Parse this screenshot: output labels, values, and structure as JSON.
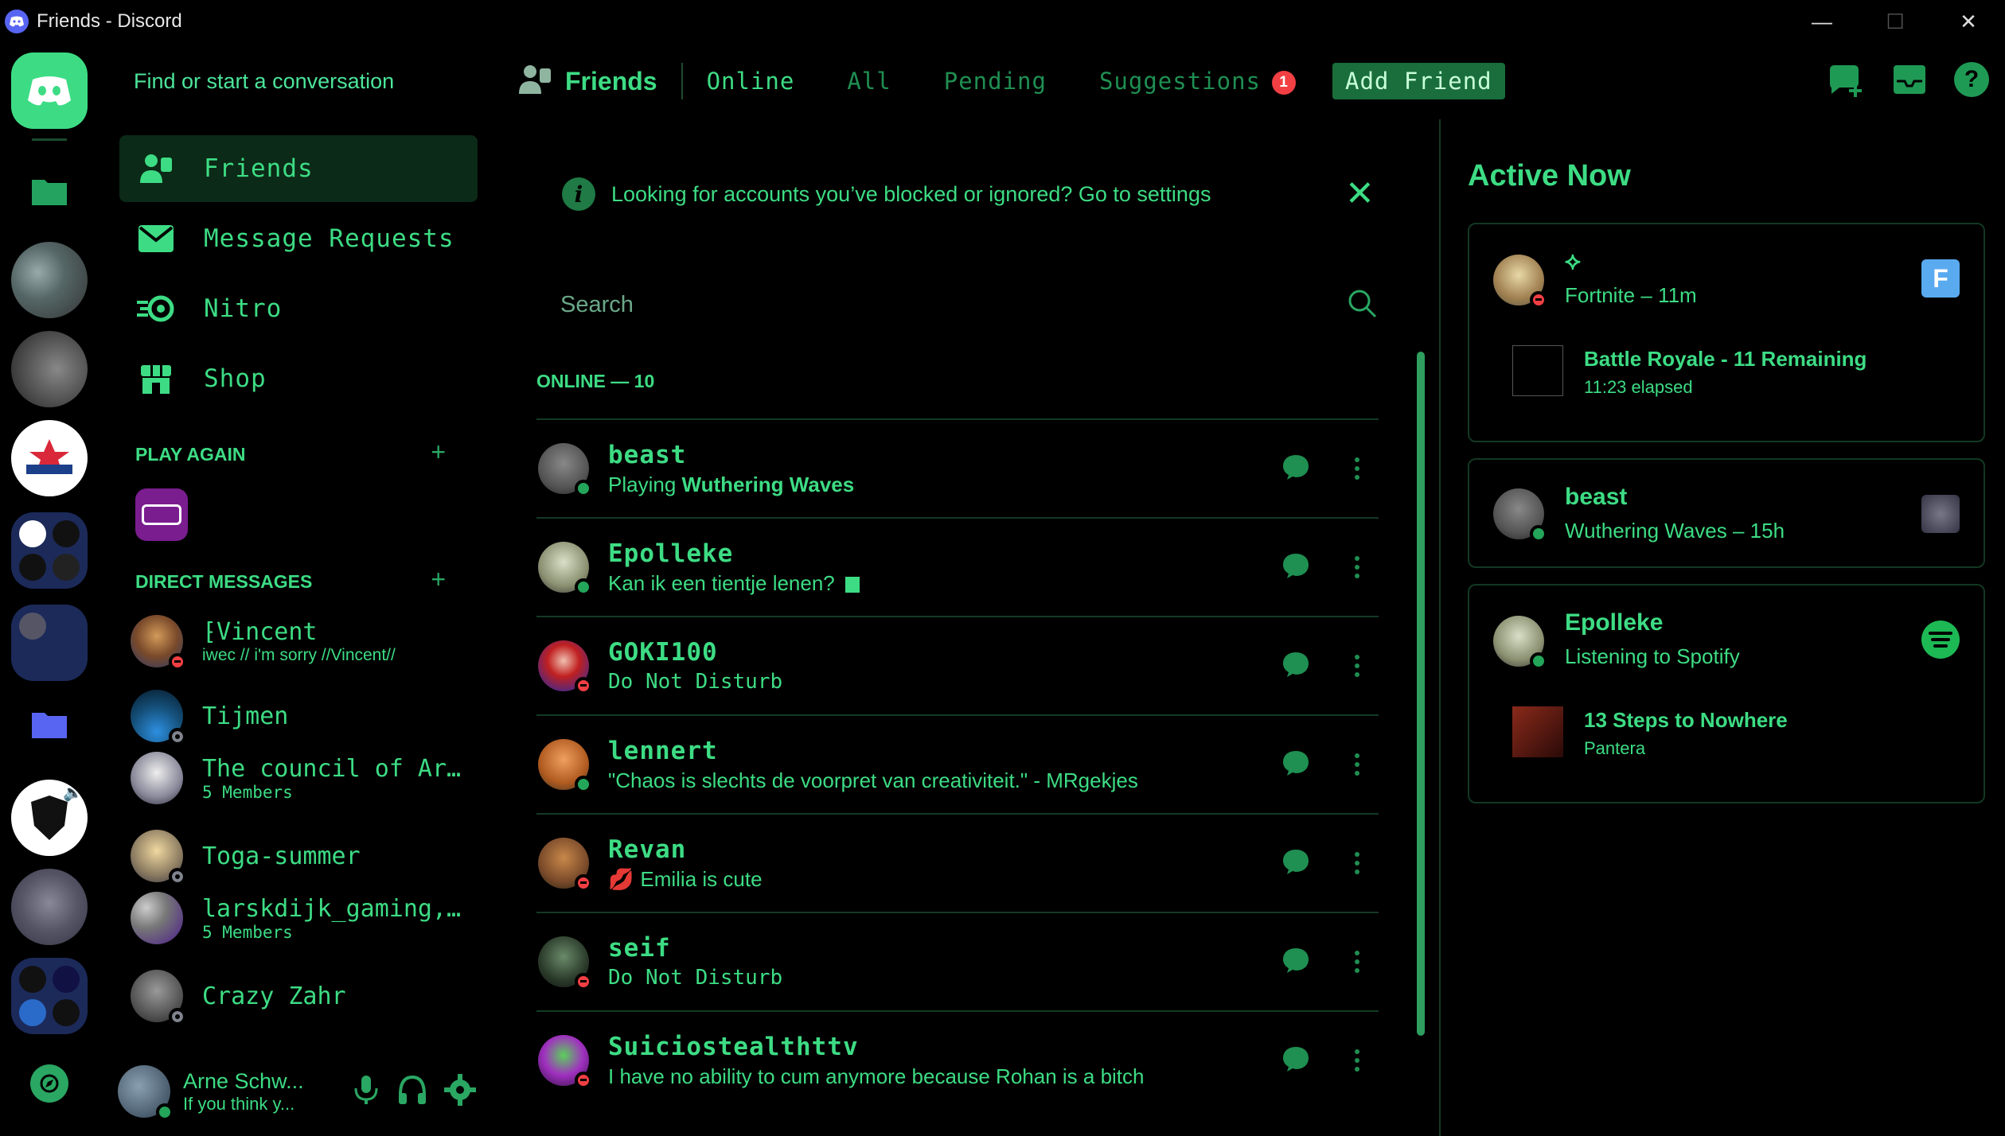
{
  "window": {
    "title": "Friends - Discord",
    "minimize": "—",
    "maximize": "☐",
    "close": "✕"
  },
  "sidebar": {
    "find_placeholder": "Find or start a conversation",
    "nav": [
      {
        "label": "Friends",
        "icon": "friends-icon",
        "active": true
      },
      {
        "label": "Message Requests",
        "icon": "envelope-icon"
      },
      {
        "label": "Nitro",
        "icon": "nitro-icon"
      },
      {
        "label": "Shop",
        "icon": "shop-icon"
      }
    ],
    "play_again_label": "PLAY AGAIN",
    "direct_messages_label": "DIRECT MESSAGES",
    "plus": "+",
    "dms": [
      {
        "name": "⁅Vincent",
        "sub": "iwec // i'm sorry //Vincent//",
        "status": "dnd"
      },
      {
        "name": "Tijmen",
        "sub": "",
        "status": "off"
      },
      {
        "name": "The council of Ar…",
        "sub": "5 Members",
        "status": ""
      },
      {
        "name": "Toga-summer",
        "sub": "",
        "status": "off"
      },
      {
        "name": "larskdijk_gaming,…",
        "sub": "5 Members",
        "status": ""
      },
      {
        "name": "Crazy Zahr",
        "sub": "",
        "status": "off"
      }
    ],
    "user": {
      "name": "Arne Schw...",
      "status": "If you think y..."
    }
  },
  "header": {
    "friends_label": "Friends",
    "tabs": [
      "Online",
      "All",
      "Pending",
      "Suggestions"
    ],
    "suggestions_badge": "1",
    "add_friend": "Add Friend"
  },
  "main": {
    "notice": "Looking for accounts you’ve blocked or ignored? Go to settings",
    "search_placeholder": "Search",
    "online_header": "ONLINE — 10",
    "friends": [
      {
        "name": "beast",
        "prefix": "Playing ",
        "bold": "Wuthering Waves",
        "suffix": "",
        "status": "on",
        "mono": false
      },
      {
        "name": "Epolleke",
        "prefix": "Kan ik een tientje lenen? ",
        "bold": "",
        "suffix": "",
        "status": "on",
        "mono": false,
        "emoji": "▤"
      },
      {
        "name": "GOKI100",
        "prefix": "Do Not Disturb",
        "bold": "",
        "suffix": "",
        "status": "dnd",
        "mono": true
      },
      {
        "name": "lennert",
        "prefix": "\"Chaos is slechts de voorpret van creativiteit.\" - MRgekjes",
        "bold": "",
        "suffix": "",
        "status": "on",
        "mono": false
      },
      {
        "name": "Revan",
        "prefix": "Emilia is cute",
        "bold": "",
        "suffix": "",
        "status": "dnd",
        "mono": false,
        "emoji": "💋"
      },
      {
        "name": "seif",
        "prefix": "Do Not Disturb",
        "bold": "",
        "suffix": "",
        "status": "dnd",
        "mono": true
      },
      {
        "name": "Suiciostealthttv",
        "prefix": "I have no ability to cum anymore because Rohan is a bitch",
        "bold": "",
        "suffix": "",
        "status": "dnd",
        "mono": false
      }
    ]
  },
  "active_now": {
    "title": "Active Now",
    "cards": [
      {
        "name": "⟡",
        "line": "Fortnite – 11m",
        "game_title": "Battle Royale - 11 Remaining",
        "game_sub": "11:23 elapsed"
      },
      {
        "name": "beast",
        "line": "Wuthering Waves – 15h"
      },
      {
        "name": "Epolleke",
        "line": "Listening to Spotify",
        "game_title": "13 Steps to Nowhere",
        "game_sub": "Pantera"
      }
    ]
  },
  "colors": {
    "accent": "#3ddc84",
    "dim": "#1f8f52",
    "online": "#23a55a",
    "dnd": "#f23f43",
    "blurple": "#5865f2"
  }
}
